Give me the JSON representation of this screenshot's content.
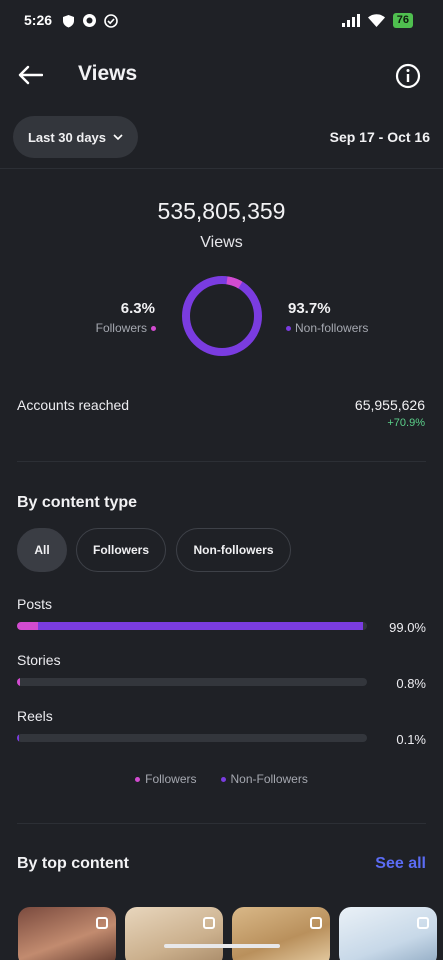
{
  "status_bar": {
    "time": "5:26",
    "battery": "76"
  },
  "header": {
    "title": "Views"
  },
  "filter": {
    "range_label": "Last 30 days",
    "date_range": "Sep 17 - Oct 16"
  },
  "summary": {
    "total_views": "535,805,359",
    "total_label": "Views",
    "followers_pct": "6.3%",
    "followers_label": "Followers",
    "non_followers_pct": "93.7%",
    "non_followers_label": "Non-followers",
    "followers_fraction": 0.063,
    "accounts_reached_label": "Accounts reached",
    "accounts_reached_value": "65,955,626",
    "accounts_reached_change": "+70.9%"
  },
  "content_type": {
    "title": "By content type",
    "chips": [
      "All",
      "Followers",
      "Non-followers"
    ],
    "active_chip": "All",
    "rows": [
      {
        "label": "Posts",
        "pct": "99.0%",
        "total": 0.99,
        "followers_share": 0.06
      },
      {
        "label": "Stories",
        "pct": "0.8%",
        "total": 0.008,
        "followers_share": 1.0
      },
      {
        "label": "Reels",
        "pct": "0.1%",
        "total": 0.001,
        "followers_share": 0.0
      }
    ],
    "legend": [
      "Followers",
      "Non-Followers"
    ]
  },
  "top_content": {
    "title": "By top content",
    "see_all": "See all"
  },
  "colors": {
    "followers": "#d24bd0",
    "non_followers": "#7a3ce0",
    "link": "#5b6cf4",
    "positive": "#5bd08a"
  }
}
